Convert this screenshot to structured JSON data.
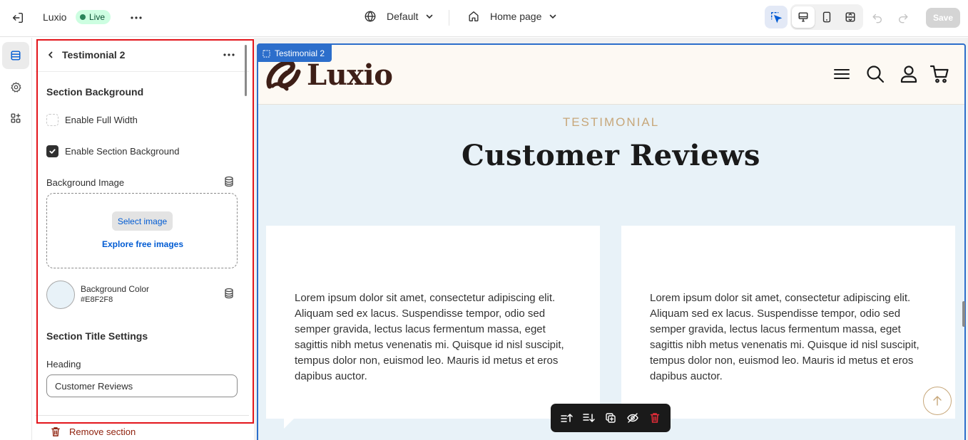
{
  "topbar": {
    "store_name": "Luxio",
    "live_label": "Live",
    "theme_label": "Default",
    "page_label": "Home page",
    "save_label": "Save"
  },
  "panel": {
    "title": "Testimonial 2",
    "section_background_heading": "Section Background",
    "enable_full_width_label": "Enable Full Width",
    "enable_full_width_checked": false,
    "enable_section_bg_label": "Enable Section Background",
    "enable_section_bg_checked": true,
    "background_image_label": "Background Image",
    "select_image_label": "Select image",
    "explore_images_label": "Explore free images",
    "background_color_label": "Background Color",
    "background_color_value": "#E8F2F8",
    "section_title_heading": "Section Title Settings",
    "heading_label": "Heading",
    "heading_value": "Customer Reviews",
    "remove_section_label": "Remove section"
  },
  "preview": {
    "selected_tag": "Testimonial 2",
    "logo_text": "Luxio",
    "eyebrow": "TESTIMONIAL",
    "title": "Customer Reviews",
    "reviews": [
      {
        "text": "Lorem ipsum dolor sit amet, consectetur adipiscing elit. Aliquam sed ex lacus. Suspendisse tempor, odio sed semper gravida, lectus lacus fermentum massa, eget sagittis nibh metus venenatis mi. Quisque id nisl suscipit, tempus dolor non, euismod leo. Mauris id metus et eros dapibus auctor."
      },
      {
        "text": "Lorem ipsum dolor sit amet, consectetur adipiscing elit. Aliquam sed ex lacus. Suspendisse tempor, odio sed semper gravida, lectus lacus fermentum massa, eget sagittis nibh metus venenatis mi. Quisque id nisl suscipit, tempus dolor non, euismod leo. Mauris id metus et eros dapibus auctor."
      }
    ]
  },
  "icons": {
    "exit": "exit-icon",
    "more": "more-horizontal-icon",
    "theme": "globe-icon",
    "page": "home-icon",
    "inspect": "inspector-cursor-icon",
    "desktop": "desktop-icon",
    "mobile": "mobile-icon",
    "fullscreen": "fullscreen-icon",
    "undo": "undo-icon",
    "redo": "redo-icon",
    "rail": [
      "sections-icon",
      "settings-gear-icon",
      "apps-icon"
    ],
    "toolbar": [
      "move-up-icon",
      "move-down-icon",
      "duplicate-icon",
      "hide-icon",
      "delete-icon"
    ]
  },
  "colors": {
    "accent_blue": "#2c6ecb",
    "highlight_red": "#e3151b",
    "live_green": "#29845a",
    "canvas_background": "#E8F2F8",
    "brand_brown": "#3e1f17",
    "eyebrow_gold": "#c7a77a",
    "delete_red": "#e22c38"
  }
}
